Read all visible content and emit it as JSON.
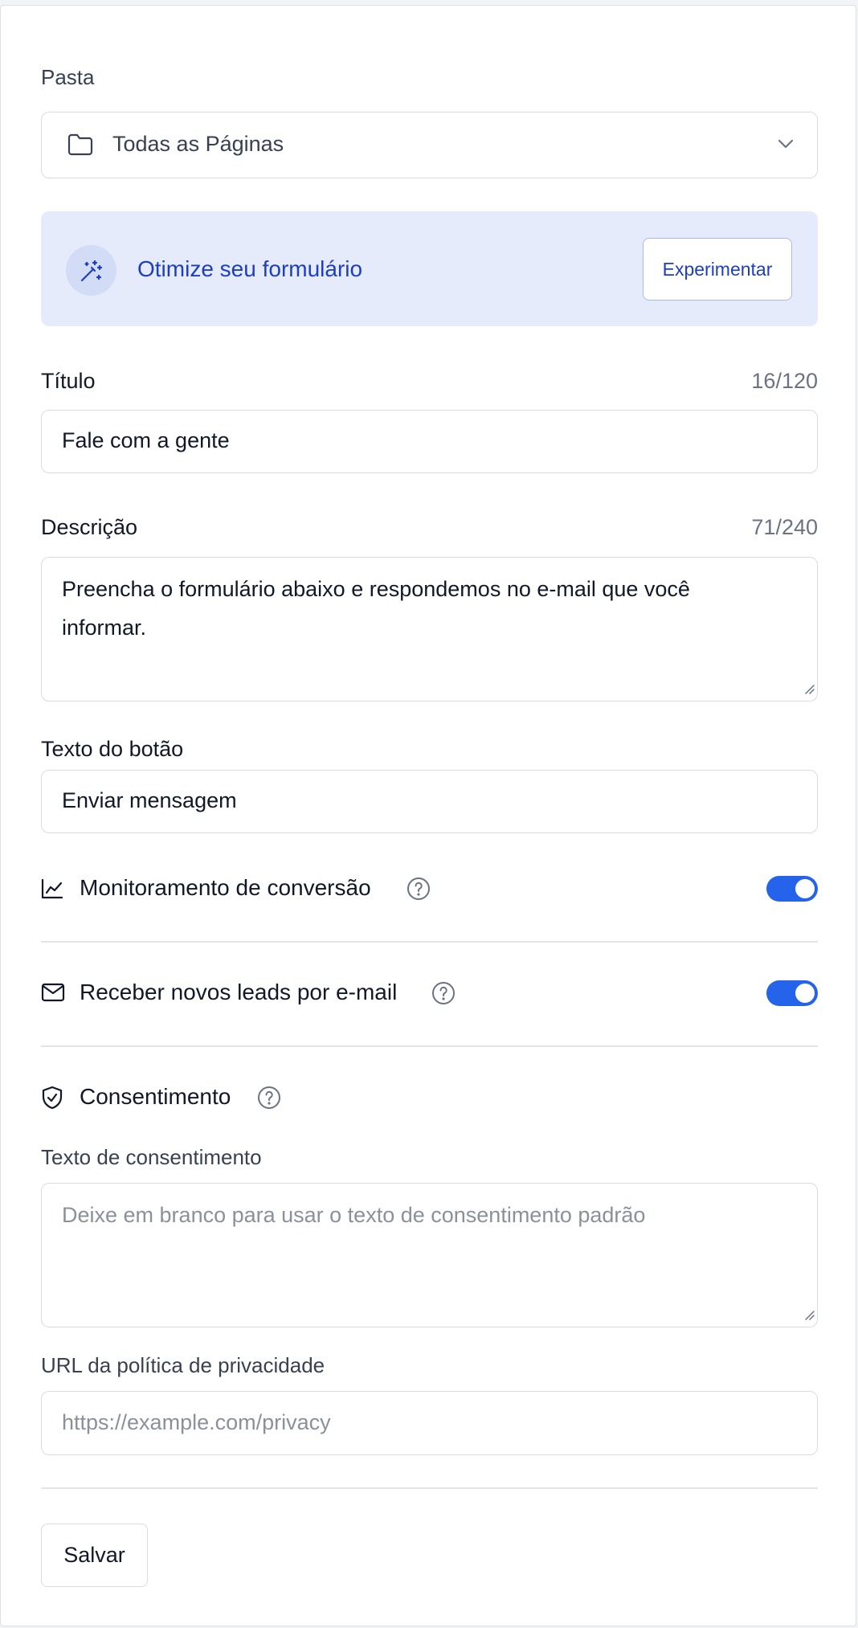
{
  "folder": {
    "label": "Pasta",
    "selected": "Todas as Páginas"
  },
  "optimize_banner": {
    "text": "Otimize seu formulário",
    "button": "Experimentar"
  },
  "title_field": {
    "label": "Título",
    "counter": "16/120",
    "value": "Fale com a gente"
  },
  "description_field": {
    "label": "Descrição",
    "counter": "71/240",
    "value_line1": "Preencha o formulário abaixo e respondemos no e-mail que você",
    "value_line2": "informar."
  },
  "button_text_field": {
    "label": "Texto do botão",
    "value": "Enviar mensagem"
  },
  "conversion_tracking": {
    "label": "Monitoramento de conversão",
    "enabled": true
  },
  "email_leads": {
    "label": "Receber novos leads por e-mail",
    "enabled": true
  },
  "consent": {
    "heading": "Consentimento",
    "text_label": "Texto de consentimento",
    "text_placeholder": "Deixe em branco para usar o texto de consentimento padrão",
    "privacy_label": "URL da política de privacidade",
    "privacy_placeholder": "https://example.com/privacy"
  },
  "save_button": "Salvar",
  "colors": {
    "accent": "#2563eb",
    "banner_bg": "#e5ebfb",
    "banner_text": "#1d3fbf"
  }
}
